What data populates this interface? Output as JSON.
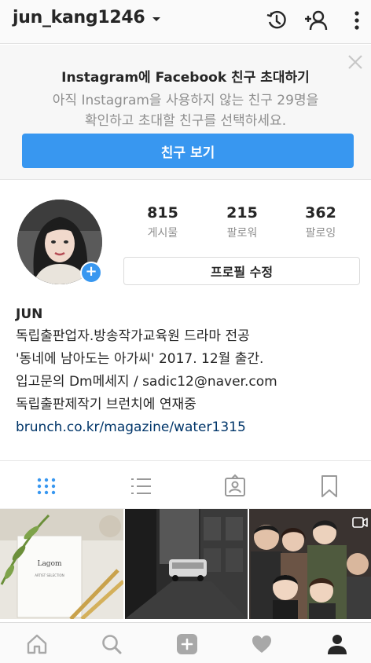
{
  "header": {
    "username": "jun_kang1246"
  },
  "facebook_banner": {
    "title": "Instagram에 Facebook 친구 초대하기",
    "description_line1": "아직 Instagram을 사용하지 않는 친구 29명을",
    "description_line2": "확인하고 초대할 친구를 선택하세요.",
    "button_label": "친구 보기"
  },
  "profile": {
    "stats": [
      {
        "value": "815",
        "label": "게시물"
      },
      {
        "value": "215",
        "label": "팔로워"
      },
      {
        "value": "362",
        "label": "팔로잉"
      }
    ],
    "edit_profile_label": "프로필 수정",
    "avatar_badge": "+"
  },
  "bio": {
    "name": "JUN",
    "lines": [
      "독립출판업자.방송작가교육원 드라마 전공",
      "'동네에 남아도는 아가씨' 2017. 12월 출간.",
      "입고문의 Dm메세지 /  sadic12@naver.com",
      "독립출판제작기 브런치에 연재중"
    ],
    "link": "brunch.co.kr/magazine/water1315"
  },
  "tiles": {
    "card_text_1": "Lagom",
    "card_text_2": "ARTIST SELECTION"
  },
  "icons": {
    "history": "history-icon",
    "add_user": "add-user-icon",
    "more": "more-vertical-icon",
    "close": "close-icon",
    "grid": "grid-icon",
    "list": "list-icon",
    "tagged": "tagged-icon",
    "saved": "bookmark-icon",
    "home": "home-icon",
    "search": "search-icon",
    "add": "add-post-icon",
    "activity": "heart-icon",
    "profile": "profile-icon"
  },
  "colors": {
    "accent": "#3897f0",
    "link": "#003569",
    "muted": "#8e8e8e",
    "text": "#262626"
  }
}
